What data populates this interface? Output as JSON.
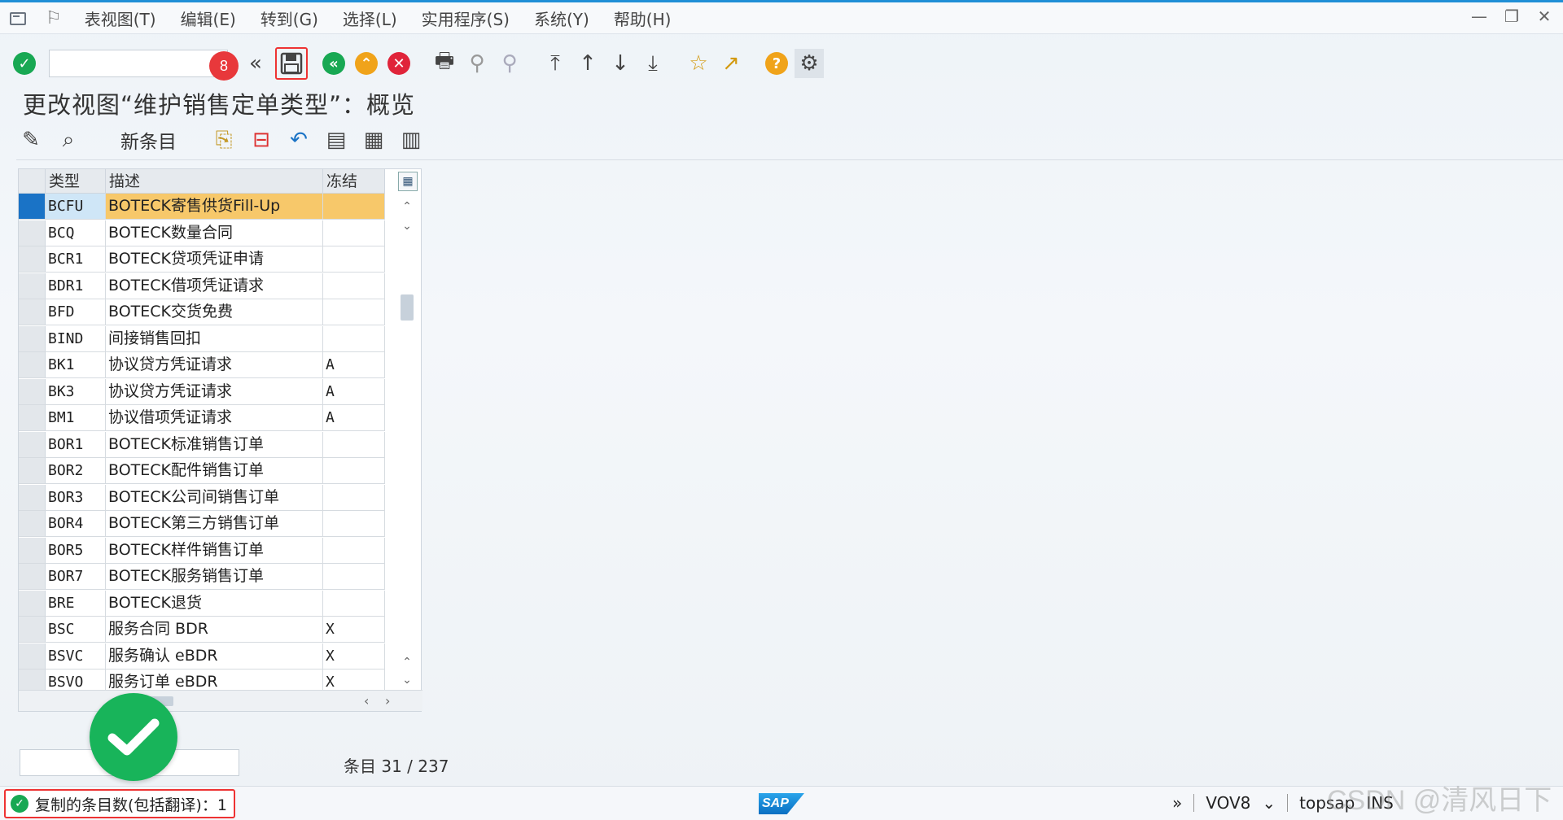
{
  "menubar": {
    "items": [
      "表视图(T)",
      "编辑(E)",
      "转到(G)",
      "选择(L)",
      "实用程序(S)",
      "系统(Y)",
      "帮助(H)"
    ]
  },
  "toolbar": {
    "command_value": "",
    "badge_count": "8"
  },
  "page": {
    "title": "更改视图“维护销售定单类型”：概览"
  },
  "app_toolbar": {
    "new_entries_label": "新条目"
  },
  "table": {
    "columns": [
      "类型",
      "描述",
      "冻结"
    ],
    "rows": [
      {
        "type": "BCFU",
        "desc": "BOTECK寄售供货Fill-Up",
        "frozen": ""
      },
      {
        "type": "BCQ",
        "desc": "BOTECK数量合同",
        "frozen": ""
      },
      {
        "type": "BCR1",
        "desc": "BOTECK贷项凭证申请",
        "frozen": ""
      },
      {
        "type": "BDR1",
        "desc": "BOTECK借项凭证请求",
        "frozen": ""
      },
      {
        "type": "BFD",
        "desc": "BOTECK交货免费",
        "frozen": ""
      },
      {
        "type": "BIND",
        "desc": "间接销售回扣",
        "frozen": ""
      },
      {
        "type": "BK1",
        "desc": "协议贷方凭证请求",
        "frozen": "A"
      },
      {
        "type": "BK3",
        "desc": "协议贷方凭证请求",
        "frozen": "A"
      },
      {
        "type": "BM1",
        "desc": "协议借项凭证请求",
        "frozen": "A"
      },
      {
        "type": "BOR1",
        "desc": "BOTECK标准销售订单",
        "frozen": ""
      },
      {
        "type": "BOR2",
        "desc": "BOTECK配件销售订单",
        "frozen": ""
      },
      {
        "type": "BOR3",
        "desc": "BOTECK公司间销售订单",
        "frozen": ""
      },
      {
        "type": "BOR4",
        "desc": "BOTECK第三方销售订单",
        "frozen": ""
      },
      {
        "type": "BOR5",
        "desc": "BOTECK样件销售订单",
        "frozen": ""
      },
      {
        "type": "BOR7",
        "desc": "BOTECK服务销售订单",
        "frozen": ""
      },
      {
        "type": "BRE",
        "desc": "BOTECK退货",
        "frozen": ""
      },
      {
        "type": "BSC",
        "desc": "服务合同 BDR",
        "frozen": "X"
      },
      {
        "type": "BSVC",
        "desc": "服务确认 eBDR",
        "frozen": "X"
      },
      {
        "type": "BSVO",
        "desc": "服务订单 eBDR",
        "frozen": "X"
      }
    ],
    "selected_row": 0
  },
  "footer": {
    "entry_count": "条目 31 / 237"
  },
  "statusbar": {
    "message": "复制的条目数(包括翻译)：1",
    "transaction": "VOV8",
    "user": "topsap",
    "mode": "INS"
  },
  "watermark": "CSDN @清风日下",
  "colors": {
    "accent": "#1f8fd6",
    "success": "#18b45a",
    "error": "#e33"
  }
}
